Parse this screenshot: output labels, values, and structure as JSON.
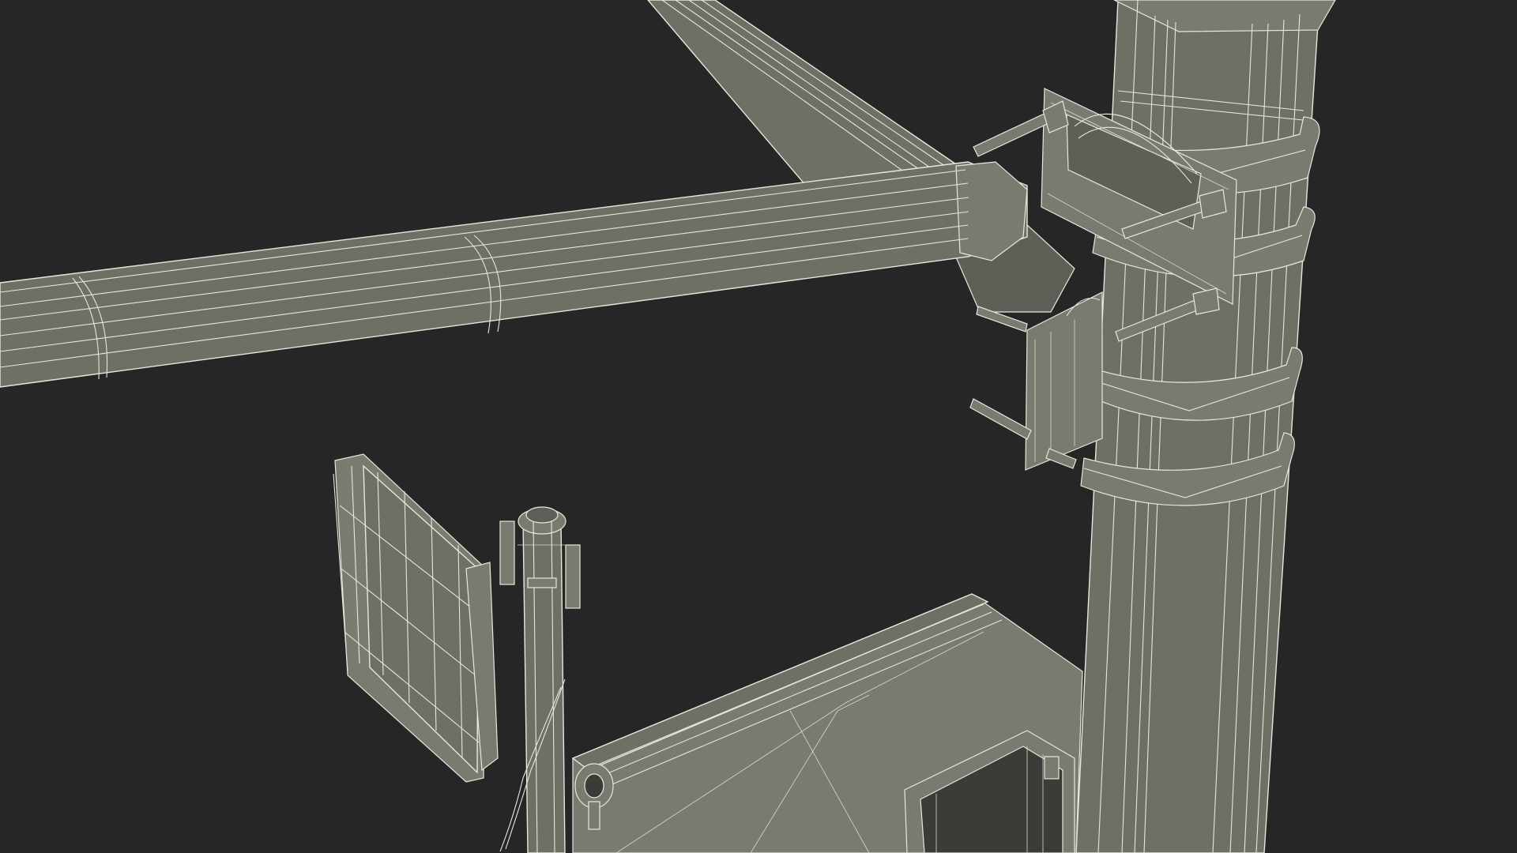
{
  "scene": {
    "background_color": "#262626",
    "mesh_fill_color": "#6f6f66",
    "wire_color": "#e7e8dc",
    "view_mode": "wireframe-on-shaded"
  }
}
